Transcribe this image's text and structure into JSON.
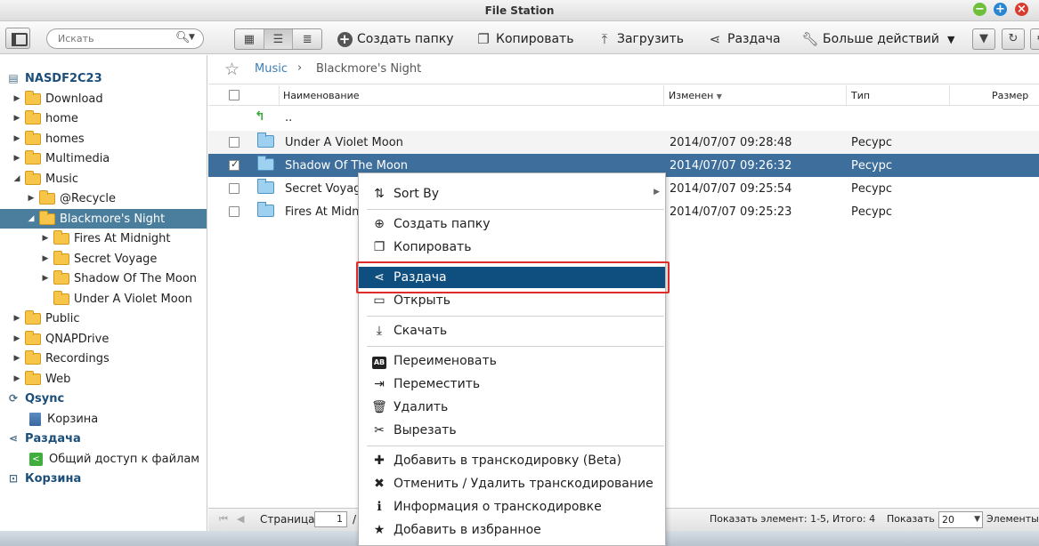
{
  "window": {
    "title": "File Station"
  },
  "toolbar": {
    "search_placeholder": "Искать",
    "create_folder": "Создать папку",
    "copy": "Копировать",
    "upload": "Загрузить",
    "share": "Раздача",
    "more_actions": "Больше действий"
  },
  "sidebar": {
    "nas_name": "NASDF2C23",
    "folders": {
      "download": "Download",
      "home": "home",
      "homes": "homes",
      "multimedia": "Multimedia",
      "music": "Music",
      "recycle": "@Recycle",
      "blackmore": "Blackmore's Night",
      "fires": "Fires At Midnight",
      "secret": "Secret Voyage",
      "shadow": "Shadow Of The Moon",
      "violet": "Under A Violet Moon",
      "public": "Public",
      "qnapdrive": "QNAPDrive",
      "recordings": "Recordings",
      "web": "Web"
    },
    "qsync": "Qsync",
    "qsync_trash": "Корзина",
    "share_section": "Раздача",
    "share_item": "Общий доступ к файлам",
    "trash_section": "Корзина"
  },
  "breadcrumb": {
    "root": "Music",
    "current": "Blackmore's Night"
  },
  "table": {
    "headers": {
      "name": "Наименование",
      "modified": "Изменен",
      "type": "Тип",
      "size": "Размер"
    },
    "parent": "..",
    "rows": [
      {
        "name": "Under A Violet Moon",
        "modified": "2014/07/07 09:28:48",
        "type": "Ресурс"
      },
      {
        "name": "Shadow Of The Moon",
        "modified": "2014/07/07 09:26:32",
        "type": "Ресурс"
      },
      {
        "name": "Secret Voyage",
        "modified": "2014/07/07 09:25:54",
        "type": "Ресурс"
      },
      {
        "name": "Fires At Midnight",
        "modified": "2014/07/07 09:25:23",
        "type": "Ресурс"
      }
    ]
  },
  "pager": {
    "page_label": "Страница",
    "page_value": "1",
    "slash": "/",
    "summary": "Показать элемент: 1-5, Итого: 4",
    "show_label": "Показать",
    "per_page": "20",
    "items_label": "Элементы"
  },
  "context_menu": {
    "sort_by": "Sort By",
    "create_folder": "Создать папку",
    "copy": "Копировать",
    "share": "Раздача",
    "open": "Открыть",
    "download": "Скачать",
    "rename": "Переименовать",
    "move": "Переместить",
    "delete": "Удалить",
    "cut": "Вырезать",
    "add_transcode": "Добавить в транскодировку (Beta)",
    "cancel_transcode": "Отменить / Удалить транскодирование",
    "transcode_info": "Информация о транскодировке",
    "add_favorite": "Добавить в избранное"
  },
  "colors": {
    "selection": "#3e6f9c",
    "menu_highlight": "#0e4f7f",
    "annotation_frame": "#e02b2b"
  }
}
